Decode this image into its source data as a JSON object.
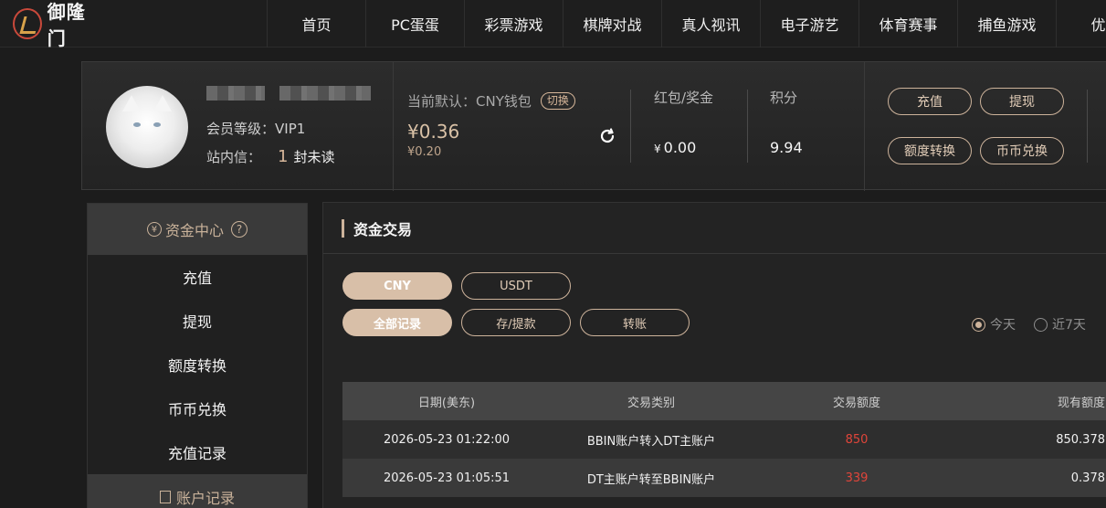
{
  "brand": {
    "name": "御隆门"
  },
  "nav": {
    "items": [
      "首页",
      "PC蛋蛋",
      "彩票游戏",
      "棋牌对战",
      "真人视讯",
      "电子游艺",
      "体育赛事",
      "捕鱼游戏",
      "优惠"
    ]
  },
  "profile": {
    "vip_label": "会员等级：",
    "vip_value": "VIP1",
    "mail_label": "站内信：",
    "mail_count": "1",
    "mail_unread": "封未读"
  },
  "wallet": {
    "label": "当前默认：CNY钱包",
    "switch_label": "切换",
    "balance": "¥0.36",
    "sub_balance": "¥0.20"
  },
  "hongbao": {
    "label": "红包/奖金",
    "yen": "¥",
    "value": "0.00"
  },
  "points": {
    "label": "积分",
    "value": "9.94"
  },
  "actions": {
    "deposit": "充值",
    "withdraw": "提现",
    "transfer": "额度转换",
    "exchange": "币币兑换"
  },
  "sidebar": {
    "head": "资金中心",
    "items": [
      {
        "label": "充值"
      },
      {
        "label": "提现"
      },
      {
        "label": "额度转换"
      },
      {
        "label": "币币兑换"
      },
      {
        "label": "充值记录"
      }
    ],
    "sub_head": "账户记录"
  },
  "main": {
    "title": "资金交易",
    "currency_tabs": [
      {
        "label": "CNY"
      },
      {
        "label": "USDT"
      }
    ],
    "type_tabs": [
      {
        "label": "全部记录"
      },
      {
        "label": "存/提款"
      },
      {
        "label": "转账"
      }
    ],
    "range": [
      {
        "label": "今天"
      },
      {
        "label": "近7天"
      }
    ],
    "table": {
      "headers": [
        "日期(美东)",
        "交易类别",
        "交易额度",
        "现有额度"
      ],
      "rows": [
        {
          "date": "2026-05-23 01:22:00",
          "type": "BBIN账户转入DT主账户",
          "amount": "850",
          "balance": "850.378"
        },
        {
          "date": "2026-05-23 01:05:51",
          "type": "DT主账户转至BBIN账户",
          "amount": "339",
          "balance": "0.378"
        }
      ]
    }
  },
  "colors": {
    "accent": "#cdb39b",
    "amount": "#e0453a",
    "background": "#1c1c1c"
  }
}
